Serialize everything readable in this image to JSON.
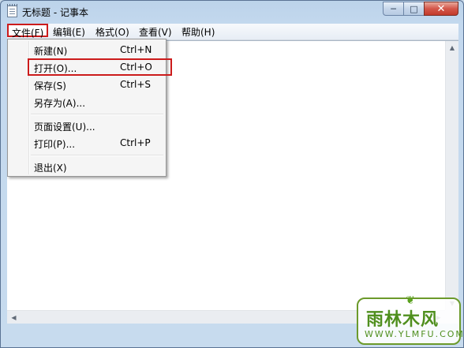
{
  "window": {
    "title": "无标题 - 记事本",
    "controls": {
      "minimize": "─",
      "maximize": "□",
      "close": "✕"
    }
  },
  "menubar": {
    "items": [
      "文件(F)",
      "编辑(E)",
      "格式(O)",
      "查看(V)",
      "帮助(H)"
    ]
  },
  "file_menu": {
    "items": [
      {
        "label": "新建(N)",
        "accel": "Ctrl+N"
      },
      {
        "label": "打开(O)...",
        "accel": "Ctrl+O"
      },
      {
        "label": "保存(S)",
        "accel": "Ctrl+S"
      },
      {
        "label": "另存为(A)...",
        "accel": ""
      },
      {
        "label": "页面设置(U)...",
        "accel": ""
      },
      {
        "label": "打印(P)...",
        "accel": "Ctrl+P"
      },
      {
        "label": "退出(X)",
        "accel": ""
      }
    ]
  },
  "scrollbar": {
    "up": "▲",
    "down": "▼",
    "left": "◀",
    "right": "▶"
  },
  "watermark": {
    "text": "雨林木风",
    "url": "WWW.YLMFU.COM"
  },
  "colors": {
    "highlight_box": "#cc1b1b",
    "watermark": "#4f8f1e"
  }
}
